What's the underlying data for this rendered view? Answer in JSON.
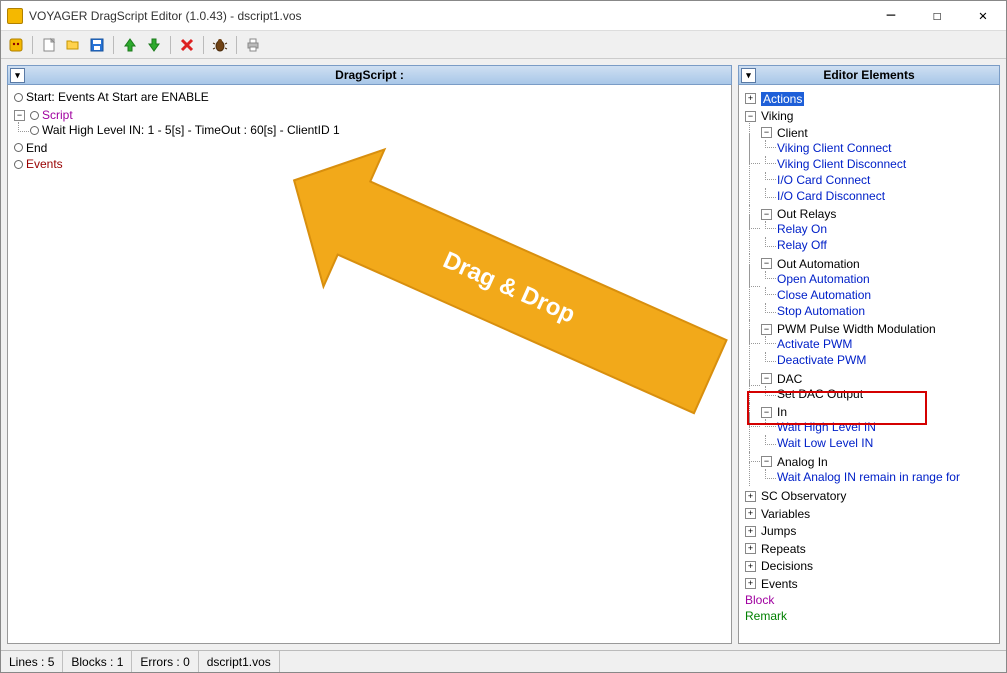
{
  "window": {
    "title": "VOYAGER DragScript Editor (1.0.43) - dscript1.vos"
  },
  "toolbar": {
    "icons": [
      "bug-yellow",
      "new",
      "open",
      "save",
      "up",
      "down",
      "delete",
      "debug",
      "print"
    ]
  },
  "panels": {
    "left_title": "DragScript :",
    "right_title": "Editor Elements"
  },
  "script_tree": {
    "start": "Start: Events At Start are ENABLE",
    "script": "Script",
    "wait_line": "Wait High Level IN: 1 - 5[s] - TimeOut : 60[s] - ClientID 1",
    "end": "End",
    "events": "Events"
  },
  "elements_tree": {
    "actions": "Actions",
    "viking": "Viking",
    "client": "Client",
    "client_items": {
      "connect": "Viking Client Connect",
      "disconnect": "Viking Client Disconnect",
      "io_connect": "I/O Card Connect",
      "io_disconnect": "I/O Card Disconnect"
    },
    "out_relays": "Out Relays",
    "relay_on": "Relay On",
    "relay_off": "Relay Off",
    "out_automation": "Out Automation",
    "open_auto": "Open Automation",
    "close_auto": "Close Automation",
    "stop_auto": "Stop Automation",
    "pwm": "PWM Pulse Width Modulation",
    "activate_pwm": "Activate PWM",
    "deactivate_pwm": "Deactivate PWM",
    "dac": "DAC",
    "set_dac": "Set DAC Output",
    "in": "In",
    "wait_high": "Wait High Level IN",
    "wait_low": "Wait Low Level IN",
    "analog_in": "Analog In",
    "wait_analog": "Wait Analog IN remain in range for",
    "sc_obs": "SC Observatory",
    "variables": "Variables",
    "jumps": "Jumps",
    "repeats": "Repeats",
    "decisions": "Decisions",
    "events": "Events",
    "block": "Block",
    "remark": "Remark"
  },
  "statusbar": {
    "lines": "Lines : 5",
    "blocks": "Blocks : 1",
    "errors": "Errors : 0",
    "file": "dscript1.vos"
  },
  "annotation": {
    "text": "Drag & Drop"
  }
}
